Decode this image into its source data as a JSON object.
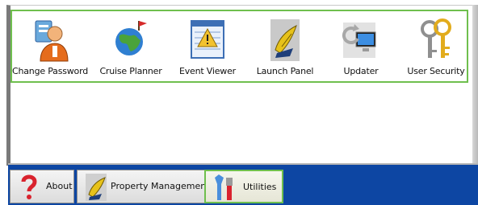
{
  "tools": [
    {
      "label": "Change Password",
      "icon": "change-password-icon"
    },
    {
      "label": "Cruise Planner",
      "icon": "cruise-planner-icon"
    },
    {
      "label": "Event Viewer",
      "icon": "event-viewer-icon"
    },
    {
      "label": "Launch Panel",
      "icon": "launch-panel-icon"
    },
    {
      "label": "Updater",
      "icon": "updater-icon"
    },
    {
      "label": "User Security",
      "icon": "user-security-icon"
    }
  ],
  "tray": {
    "tabs": [
      {
        "label": "About",
        "icon": "about-icon",
        "active": false
      },
      {
        "label": "Property Management",
        "icon": "property-management-icon",
        "active": false
      },
      {
        "label": "Utilities",
        "icon": "utilities-icon",
        "active": true
      }
    ]
  },
  "colors": {
    "highlight": "#6fbf4e",
    "tray_background": "#0d46a3"
  }
}
